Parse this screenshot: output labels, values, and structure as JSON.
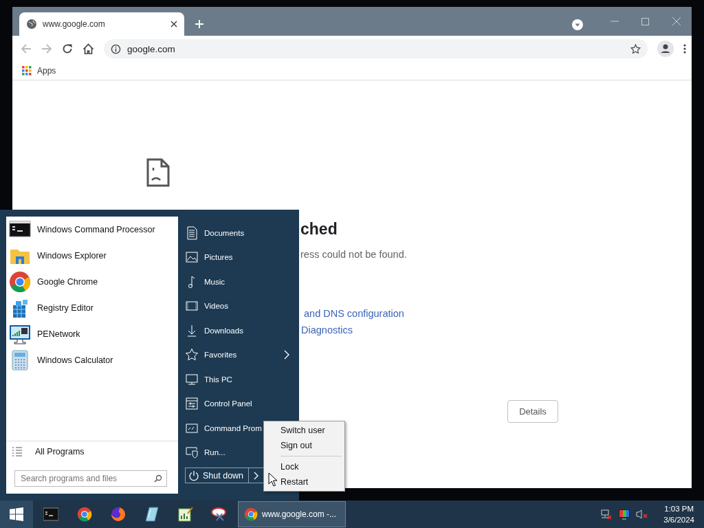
{
  "browser": {
    "tab": {
      "title": "www.google.com"
    },
    "address": "google.com",
    "bookmarks": [
      {
        "label": "Apps"
      }
    ],
    "page": {
      "heading": "ched",
      "message": "ress could not be found.",
      "links": [
        "and DNS configuration",
        "Diagnostics"
      ],
      "button": "Details"
    }
  },
  "start_menu": {
    "programs": [
      {
        "label": "Windows Command Processor",
        "kind": "cmd"
      },
      {
        "label": "Windows Explorer",
        "kind": "folder"
      },
      {
        "label": "Google Chrome",
        "kind": "chrome"
      },
      {
        "label": "Registry Editor",
        "kind": "registry"
      },
      {
        "label": "PENetwork",
        "kind": "network"
      },
      {
        "label": "Windows Calculator",
        "kind": "calculator"
      }
    ],
    "all_programs": "All Programs",
    "search": {
      "placeholder": "Search programs and files"
    },
    "places": [
      {
        "label": "Documents",
        "kind": "document",
        "submenu": false
      },
      {
        "label": "Pictures",
        "kind": "picture",
        "submenu": false
      },
      {
        "label": "Music",
        "kind": "music",
        "submenu": false
      },
      {
        "label": "Videos",
        "kind": "film",
        "submenu": false
      },
      {
        "label": "Downloads",
        "kind": "download",
        "submenu": false
      },
      {
        "label": "Favorites",
        "kind": "star",
        "submenu": true
      },
      {
        "label": "This PC",
        "kind": "monitor",
        "submenu": false
      },
      {
        "label": "Control Panel",
        "kind": "panel",
        "submenu": false
      },
      {
        "label": "Command Prom",
        "kind": "console"
      },
      {
        "label": "Run...",
        "kind": "run"
      }
    ],
    "shutdown": {
      "label": "Shut down"
    }
  },
  "power_menu": {
    "groups": [
      [
        "Switch user",
        "Sign out"
      ],
      [
        "Lock",
        "Restart"
      ]
    ]
  },
  "taskbar": {
    "window_button": {
      "label": "www.google.com -...",
      "selected": true
    },
    "time": "1:03 PM",
    "date": "3/6/2024"
  }
}
